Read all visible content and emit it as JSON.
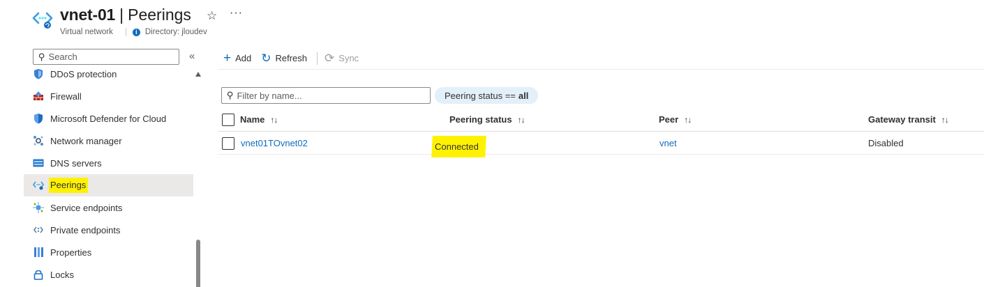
{
  "header": {
    "resource_name": "vnet-01",
    "blade_title": "Peerings",
    "resource_type": "Virtual network",
    "directory": "Directory: jloudev"
  },
  "sidebar": {
    "search_placeholder": "Search",
    "items": [
      {
        "label": "DDoS protection",
        "icon": "ddos-shield-icon"
      },
      {
        "label": "Firewall",
        "icon": "firewall-icon"
      },
      {
        "label": "Microsoft Defender for Cloud",
        "icon": "defender-shield-icon"
      },
      {
        "label": "Network manager",
        "icon": "network-manager-icon"
      },
      {
        "label": "DNS servers",
        "icon": "dns-servers-icon"
      },
      {
        "label": "Peerings",
        "icon": "peerings-icon",
        "active": true
      },
      {
        "label": "Service endpoints",
        "icon": "service-endpoints-icon"
      },
      {
        "label": "Private endpoints",
        "icon": "private-endpoints-icon"
      },
      {
        "label": "Properties",
        "icon": "properties-icon"
      },
      {
        "label": "Locks",
        "icon": "lock-icon"
      }
    ]
  },
  "toolbar": {
    "add_label": "Add",
    "refresh_label": "Refresh",
    "sync_label": "Sync"
  },
  "filter": {
    "placeholder": "Filter by name...",
    "pill_prefix": "Peering status ==",
    "pill_value": "all"
  },
  "table": {
    "columns": [
      "Name",
      "Peering status",
      "Peer",
      "Gateway transit"
    ],
    "rows": [
      {
        "name": "vnet01TOvnet02",
        "status": "Connected",
        "peer": "vnet",
        "gateway_transit": "Disabled"
      }
    ]
  },
  "colors": {
    "accent": "#0f6cbd",
    "highlight": "#fff200",
    "active_nav": "#ebe9e8",
    "pill": "#e3eff9"
  }
}
